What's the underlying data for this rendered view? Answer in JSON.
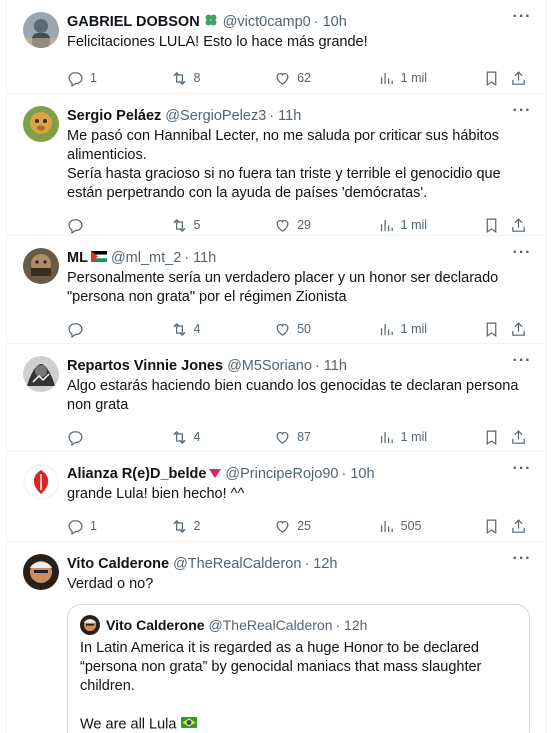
{
  "tweets": [
    {
      "name": "GABRIEL DOBSON",
      "handle": "@vict0camp0",
      "time": "· 10h",
      "text": "Felicitaciones LULA! Esto lo hace más grande!",
      "replies": "1",
      "retweets": "8",
      "likes": "62",
      "views": "1 mil"
    },
    {
      "name": "Sergio Peláez",
      "handle": "@SergioPelez3",
      "time": "· 11h",
      "text": "Me pasó con Hannibal Lecter, no me saluda por criticar sus hábitos alimenticios.\nSería hasta gracioso si no fuera tan triste y terrible el genocidio que están perpetrando con la ayuda de países 'demócratas'.",
      "replies": "",
      "retweets": "5",
      "likes": "29",
      "views": "1 mil"
    },
    {
      "name": "ML",
      "handle": "@ml_mt_2",
      "time": "· 11h",
      "text": "Personalmente sería un verdadero placer y un honor ser declarado \"persona non grata\" por el régimen Zionista",
      "replies": "",
      "retweets": "4",
      "likes": "50",
      "views": "1 mil"
    },
    {
      "name": "Repartos Vinnie Jones",
      "handle": "@M5Soriano",
      "time": "· 11h",
      "text": "Algo estarás haciendo bien cuando los genocidas te declaran persona non grata",
      "replies": "",
      "retweets": "4",
      "likes": "87",
      "views": "1 mil"
    },
    {
      "name": "Alianza R(e)D_belde",
      "handle": "@PrincipeRojo90",
      "time": "· 10h",
      "text": "grande Lula! bien hecho! ^^",
      "replies": "1",
      "retweets": "2",
      "likes": "25",
      "views": "505"
    },
    {
      "name": "Vito Calderone",
      "handle": "@TheRealCalderon",
      "time": "· 12h",
      "text": "Verdad o no?",
      "quote": {
        "name": "Vito Calderone",
        "handle": "@TheRealCalderon",
        "time": "· 12h",
        "text": "In Latin America it is regarded as a huge Honor to be declared “persona non grata” by genocidal maniacs that mass slaughter children.\n\nWe are all Lula",
        "ellipsis": "..."
      }
    }
  ],
  "colors": {
    "text": "#0f1419",
    "secondary": "#536471",
    "border": "#eff3f4",
    "clover": "#3ba55c",
    "red_triangle": "#e0245e"
  },
  "icons": [
    "reply-icon",
    "retweet-icon",
    "heart-icon",
    "views-icon",
    "bookmark-icon",
    "share-icon",
    "more-icon"
  ]
}
